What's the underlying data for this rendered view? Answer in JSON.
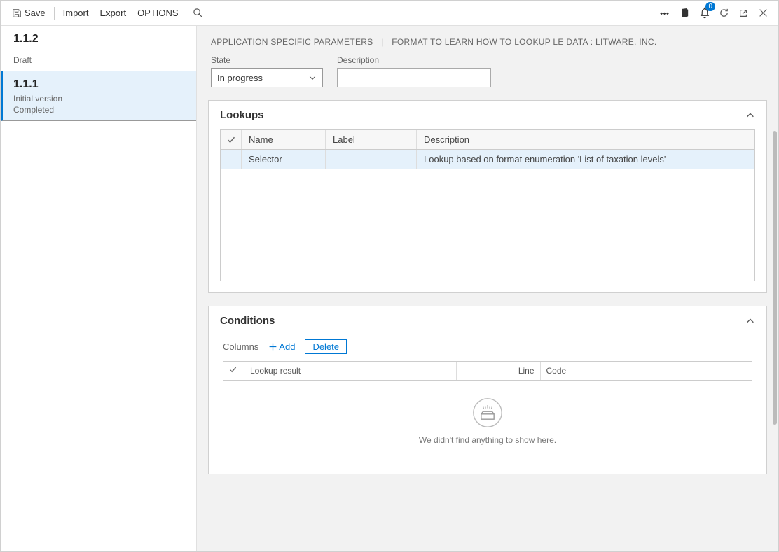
{
  "toolbar": {
    "save_label": "Save",
    "import_label": "Import",
    "export_label": "Export",
    "options_label": "OPTIONS",
    "badge_count": "0"
  },
  "sidebar": {
    "versions": [
      {
        "title": "1.1.2",
        "sub1": "Draft",
        "sub2": ""
      },
      {
        "title": "1.1.1",
        "sub1": "Initial version",
        "sub2": "Completed"
      }
    ]
  },
  "breadcrumb": {
    "part1": "APPLICATION SPECIFIC PARAMETERS",
    "part2": "FORMAT TO LEARN HOW TO LOOKUP LE DATA : LITWARE, INC."
  },
  "fields": {
    "state_label": "State",
    "state_value": "In progress",
    "description_label": "Description",
    "description_value": ""
  },
  "lookups": {
    "title": "Lookups",
    "columns": {
      "name": "Name",
      "label": "Label",
      "description": "Description"
    },
    "rows": [
      {
        "name": "Selector",
        "label": "",
        "description": "Lookup based on format enumeration 'List of taxation levels'"
      }
    ]
  },
  "conditions": {
    "title": "Conditions",
    "columns_label": "Columns",
    "add_label": "Add",
    "delete_label": "Delete",
    "headers": {
      "result": "Lookup result",
      "line": "Line",
      "code": "Code"
    },
    "empty_text": "We didn't find anything to show here."
  }
}
